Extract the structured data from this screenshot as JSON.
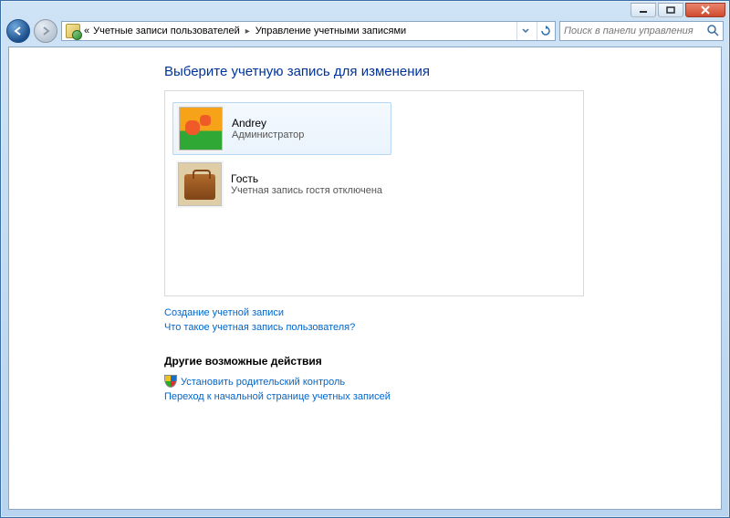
{
  "titlebar": {
    "minimize": "Minimize",
    "maximize": "Maximize",
    "close": "Close"
  },
  "breadcrumb": {
    "prefix": "«",
    "seg1": "Учетные записи пользователей",
    "seg2": "Управление учетными записями"
  },
  "search": {
    "placeholder": "Поиск в панели управления"
  },
  "page": {
    "title": "Выберите учетную запись для изменения"
  },
  "accounts": [
    {
      "name": "Andrey",
      "role": "Администратор"
    },
    {
      "name": "Гость",
      "role": "Учетная запись гостя отключена"
    }
  ],
  "links": {
    "create": "Создание учетной записи",
    "what": "Что такое учетная запись пользователя?"
  },
  "otherSection": "Другие возможные действия",
  "otherLinks": {
    "parental": "Установить родительский контроль",
    "goHome": "Переход к начальной странице учетных записей"
  }
}
